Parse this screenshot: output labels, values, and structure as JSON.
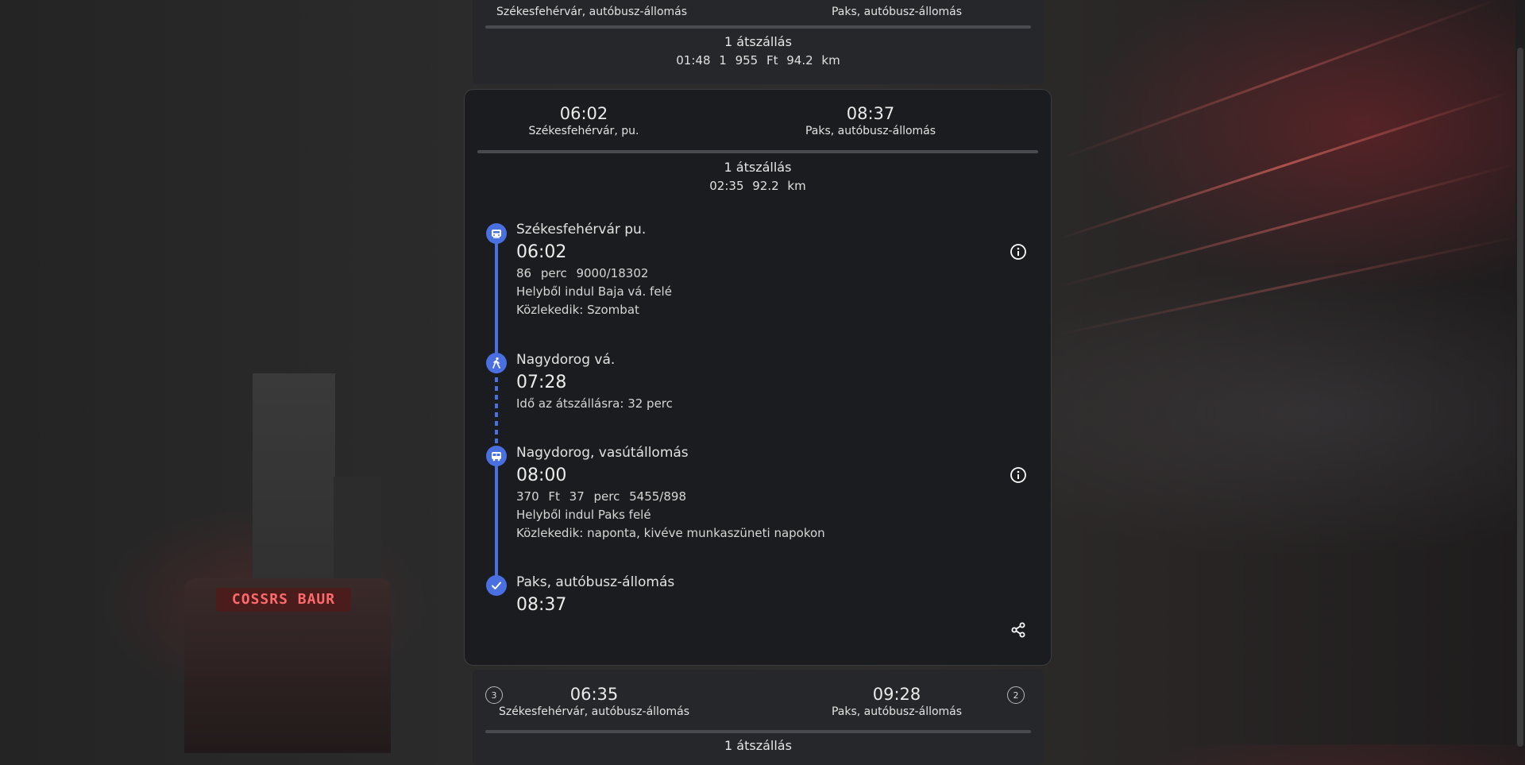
{
  "colors": {
    "accent": "#4a6fe0",
    "card": "#1b1c1f",
    "card_collapsed": "#26272b"
  },
  "background": {
    "bus_sign": "COSSRS BAUR"
  },
  "route_prev": {
    "from_place": "Székesfehérvár, autóbusz-állomás",
    "to_place": "Paks, autóbusz-állomás",
    "changes": "1 átszállás",
    "stats": "01:48 1 955 Ft 94.2 km"
  },
  "route_current": {
    "dep_time": "06:02",
    "from_place": "Székesfehérvár, pu.",
    "arr_time": "08:37",
    "to_place": "Paks, autóbusz-állomás",
    "changes": "1 átszállás",
    "stats": "02:35 92.2 km",
    "legs": [
      {
        "icon": "train-icon",
        "stop": "Székesfehérvár pu.",
        "time": "06:02",
        "meta": "86 perc 9000/18302",
        "direction": "Helyből indul Baja vá. felé",
        "operates": "Közlekedik: Szombat"
      },
      {
        "icon": "walk-icon",
        "stop": "Nagydorog vá.",
        "time": "07:28",
        "transfer": "Idő az átszállásra: 32 perc"
      },
      {
        "icon": "bus-icon",
        "stop": "Nagydorog, vasútállomás",
        "time": "08:00",
        "meta": "370 Ft 37 perc 5455/898",
        "direction": "Helyből indul Paks felé",
        "operates": "Közlekedik: naponta, kivéve munkaszüneti napokon"
      },
      {
        "icon": "check-icon",
        "stop": "Paks, autóbusz-állomás",
        "time": "08:37"
      }
    ]
  },
  "route_next": {
    "rank_left": "3",
    "dep_time": "06:35",
    "from_place": "Székesfehérvár, autóbusz-állomás",
    "arr_time": "09:28",
    "to_place": "Paks, autóbusz-állomás",
    "rank_right": "2",
    "changes": "1 átszállás"
  }
}
